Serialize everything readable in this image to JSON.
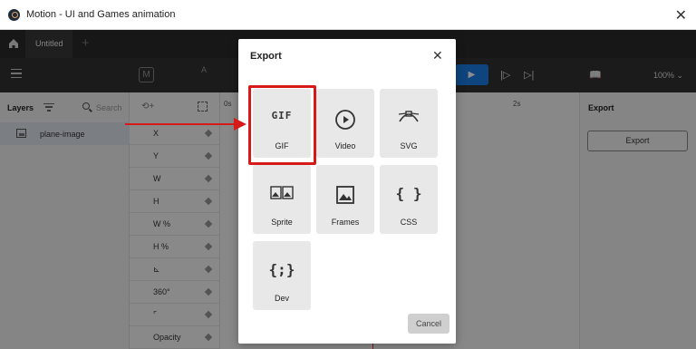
{
  "window": {
    "title": "Motion - UI and Games animation"
  },
  "tabs": {
    "active_label": "Untitled",
    "add_label": "+"
  },
  "toolbar": {
    "zoom": "100%",
    "a_label": "A"
  },
  "layers": {
    "title": "Layers",
    "search_placeholder": "Search",
    "items": [
      {
        "name": "plane-image"
      }
    ]
  },
  "properties": {
    "rows": [
      {
        "label": "X"
      },
      {
        "label": "Y"
      },
      {
        "label": "W"
      },
      {
        "label": "H"
      },
      {
        "label": "W %"
      },
      {
        "label": "H %"
      },
      {
        "label": "⊾"
      },
      {
        "label": "360°"
      },
      {
        "label": "⌜"
      },
      {
        "label": "Opacity"
      }
    ]
  },
  "timeline": {
    "marker_0": "0s",
    "marker_2": "2s"
  },
  "right_panel": {
    "title": "Export",
    "button_label": "Export"
  },
  "modal": {
    "title": "Export",
    "tiles": [
      {
        "label": "GIF",
        "icon": "gif-icon",
        "icon_text": "GIF"
      },
      {
        "label": "Video",
        "icon": "play-circle-icon"
      },
      {
        "label": "SVG",
        "icon": "bezier-icon"
      },
      {
        "label": "Sprite",
        "icon": "sprite-icon"
      },
      {
        "label": "Frames",
        "icon": "image-icon"
      },
      {
        "label": "CSS",
        "icon": "braces-icon",
        "icon_text": "{ }"
      },
      {
        "label": "Dev",
        "icon": "code-braces-icon",
        "icon_text": "{;}"
      }
    ],
    "cancel_label": "Cancel"
  },
  "colors": {
    "accent": "#1a7fe6",
    "highlight": "#d61a1a"
  }
}
